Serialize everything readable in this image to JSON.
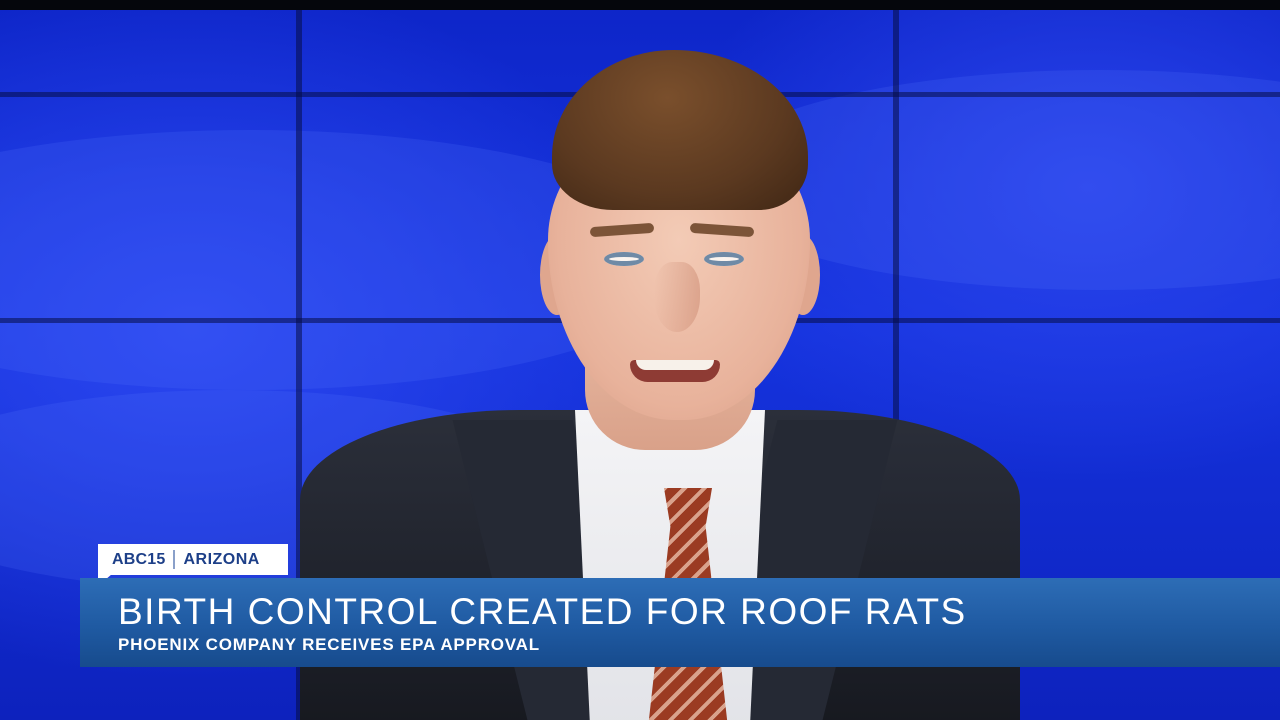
{
  "lower_third": {
    "network": "ABC15",
    "region": "ARIZONA",
    "headline": "BIRTH CONTROL CREATED FOR ROOF RATS",
    "subheadline": "PHOENIX COMPANY RECEIVES EPA APPROVAL"
  },
  "colors": {
    "backdrop": "#1533de",
    "banner": "#1f5aa2",
    "bug_background": "#ffffff",
    "bug_text": "#1d3f88"
  }
}
